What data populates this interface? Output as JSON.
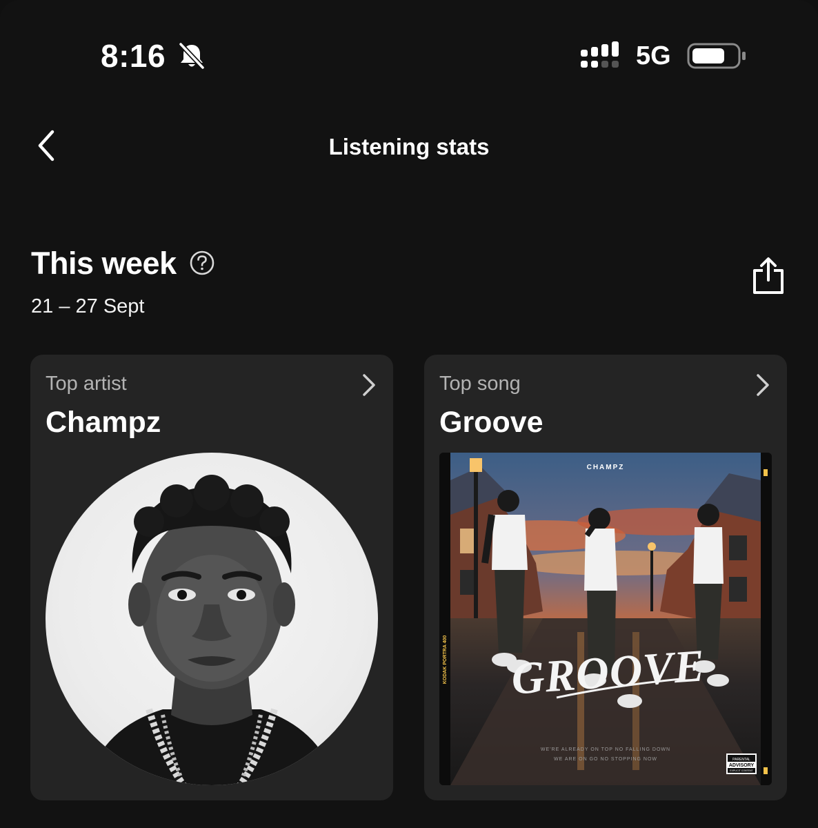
{
  "status_bar": {
    "time": "8:16",
    "network": "5G",
    "icons": [
      "bell-off-icon",
      "signal-icon",
      "battery-icon"
    ]
  },
  "nav": {
    "title": "Listening stats",
    "back_icon": "chevron-left-icon"
  },
  "section": {
    "title": "This week",
    "date_range": "21 – 27 Sept",
    "help_icon": "question-circle-icon",
    "share_icon": "share-icon"
  },
  "cards": {
    "top_artist": {
      "label": "Top artist",
      "value": "Champz"
    },
    "top_song": {
      "label": "Top song",
      "value": "Groove"
    }
  },
  "album_art": {
    "artist_text": "CHAMPZ",
    "title_text": "GROOVE",
    "subtitle_line1": "WE'RE ALREADY ON TOP NO FALLING DOWN",
    "subtitle_line2": "WE ARE ON GO NO STOPPING NOW",
    "film_text": "KODAK PORTRA 400",
    "advisory_line1": "PARENTAL",
    "advisory_line2": "ADVISORY",
    "advisory_line3": "EXPLICIT CONTENT"
  },
  "colors": {
    "background": "#121212",
    "card": "#242424",
    "secondary_text": "#b3b3b3"
  }
}
